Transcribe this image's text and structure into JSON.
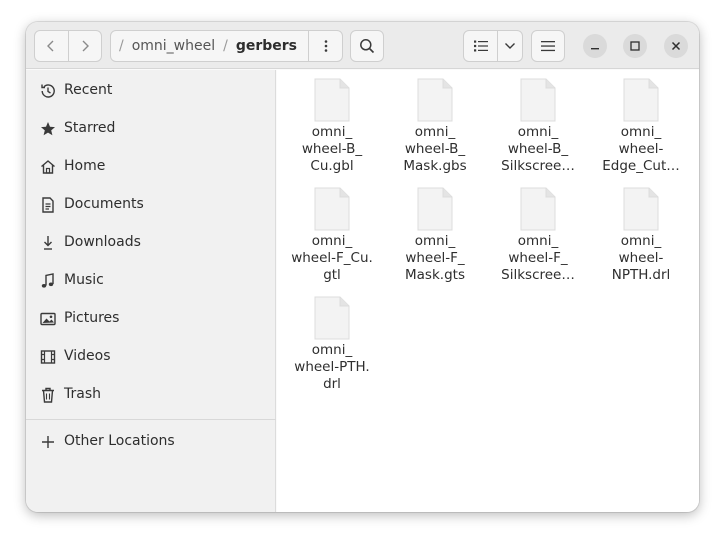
{
  "path": {
    "parent": "omni_wheel",
    "current": "gerbers",
    "separator": "/"
  },
  "sidebar": {
    "items": [
      {
        "label": "Recent",
        "icon": "clock-icon"
      },
      {
        "label": "Starred",
        "icon": "star-icon"
      },
      {
        "label": "Home",
        "icon": "home-icon"
      },
      {
        "label": "Documents",
        "icon": "document-icon"
      },
      {
        "label": "Downloads",
        "icon": "download-icon"
      },
      {
        "label": "Music",
        "icon": "music-icon"
      },
      {
        "label": "Pictures",
        "icon": "picture-icon"
      },
      {
        "label": "Videos",
        "icon": "video-icon"
      },
      {
        "label": "Trash",
        "icon": "trash-icon"
      }
    ],
    "other": {
      "label": "Other Locations",
      "icon": "plus-icon"
    }
  },
  "files": [
    {
      "name": "omni_\nwheel-B_\nCu.gbl"
    },
    {
      "name": "omni_\nwheel-B_\nMask.gbs"
    },
    {
      "name": "omni_\nwheel-B_\nSilkscree…"
    },
    {
      "name": "omni_\nwheel-\nEdge_Cut…"
    },
    {
      "name": "omni_\nwheel-F_Cu.\ngtl"
    },
    {
      "name": "omni_\nwheel-F_\nMask.gts"
    },
    {
      "name": "omni_\nwheel-F_\nSilkscree…"
    },
    {
      "name": "omni_\nwheel-\nNPTH.drl"
    },
    {
      "name": "omni_\nwheel-PTH.\ndrl"
    }
  ]
}
